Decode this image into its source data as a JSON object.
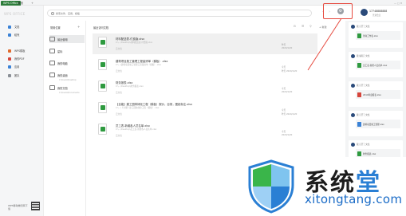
{
  "tabs": {
    "app": "WPS Office",
    "home": "首页",
    "add": "+"
  },
  "sidebar": {
    "logo": "WPS OFFICE",
    "items": [
      {
        "label": "文档",
        "color": "#3b82d6"
      },
      {
        "label": "稻壳",
        "color": "#3b82d6"
      },
      {
        "label": "WPS模板",
        "color": "#e06b2d"
      },
      {
        "label": "我的PDF",
        "color": "#d6453b"
      },
      {
        "label": "应用",
        "color": "#3b82d6"
      },
      {
        "label": "团队",
        "color": "#8a8f96"
      }
    ],
    "qr_label": "WPS移动端扫码下载"
  },
  "search": {
    "placeholder": "搜索文件、应用、模板"
  },
  "user": {
    "name": "17748888888",
    "sub": "普通会员",
    "gear": "⚙",
    "controls": "— □ ✕"
  },
  "folders": {
    "header": "常用位置",
    "add": "+",
    "items": [
      {
        "label": "最近使用",
        "sub": ""
      },
      {
        "label": "星标",
        "sub": ""
      },
      {
        "label": "我的电脑",
        "sub": ""
      },
      {
        "label": "我的桌面",
        "sub": "C:\\Users\\Desktop"
      },
      {
        "label": "我的文档",
        "sub": "C:\\Users\\Documents"
      }
    ]
  },
  "files": {
    "header": "最近访问文档",
    "tools": "⊟ ☰ ⚲",
    "new_label": "+ 新建",
    "rows": [
      {
        "title": "材料配送表-付费版.xlsx",
        "line1": "C:\\...\\Desktop\\材料配送表-付费版.xlsx",
        "line2": "",
        "meta1": "昨天",
        "meta2": "2020/1/20"
      },
      {
        "title": "建筑项目施工管理工程量清单（模板）.xlsx",
        "line1": "C:\\...\\建筑项目施工管理工程量清单（模板）.xlsx",
        "line2": "",
        "meta1": "今天",
        "meta2": "昨天 2020/1/20"
      },
      {
        "title": "财务报表.xlsx",
        "line1": "C:\\...\\Desktop\\财务报表.xlsx",
        "line2": "",
        "meta1": "今天",
        "meta2": "2020/1/20"
      },
      {
        "title": "【全能】建工园林绿化工程（模板）报价，目录，图纸标注.xlsx",
        "line1": "C:\\...\\【全能】建工园林绿化工程（模板）.xlsx",
        "line2": "",
        "meta1": "今天",
        "meta2": "昨天 2020/1/20"
      },
      {
        "title": "员工表-新增各人员名单.xlsx",
        "line1": "C:\\...\\Desktop\\员工表-新增各人员名单.xlsx",
        "line2": "",
        "meta1": "今天",
        "meta2": "2020/1/20"
      }
    ],
    "tag": "云文档"
  },
  "activity": {
    "cards": [
      {
        "user": "我 打开了文档",
        "file": "到岗工作表.xlsx",
        "color": "#2e9a3f"
      },
      {
        "user": "我 编辑了文档",
        "file": "员工表-新增人员名单.xlsx",
        "color": "#2e9a3f"
      },
      {
        "user": "我 打开了文档",
        "file": "2019年度报表.xlsx",
        "color": "#d6453b"
      },
      {
        "user": "我 打开了文档",
        "file": "建筑项目施工管理.xlsx",
        "color": "#3b82d6"
      },
      {
        "user": "我 打开了文档",
        "file": "财务报表.xlsx",
        "color": "#2e9a3f"
      }
    ]
  },
  "watermark": {
    "text_a": "系统",
    "text_b": "堂",
    "url": "xitongtang.com",
    "colors": {
      "blue": "#2a7fd4",
      "green": "#3ab54a"
    }
  },
  "colors": {
    "accent": "#2e9a3f",
    "highlight": "#e64a3f"
  }
}
